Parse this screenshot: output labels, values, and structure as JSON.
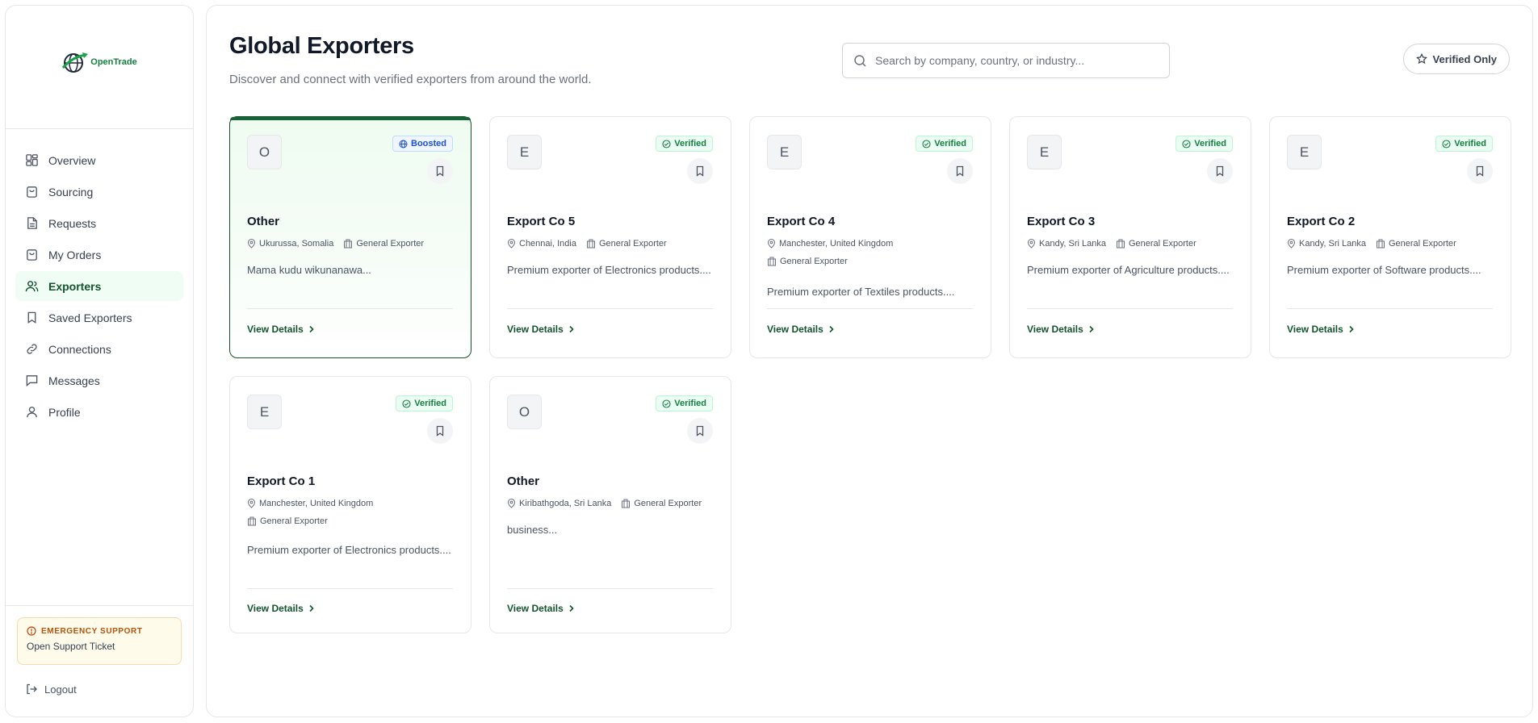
{
  "app": {
    "logo_text": "OpenTrade"
  },
  "sidebar": {
    "items": [
      {
        "label": "Overview",
        "icon": "grid-icon"
      },
      {
        "label": "Sourcing",
        "icon": "shopping-bag-icon"
      },
      {
        "label": "Requests",
        "icon": "document-icon"
      },
      {
        "label": "My Orders",
        "icon": "shopping-bag-icon"
      },
      {
        "label": "Exporters",
        "icon": "users-icon",
        "active": true
      },
      {
        "label": "Saved Exporters",
        "icon": "bookmark-icon"
      },
      {
        "label": "Connections",
        "icon": "link-icon"
      },
      {
        "label": "Messages",
        "icon": "message-icon"
      },
      {
        "label": "Profile",
        "icon": "user-icon"
      }
    ],
    "emergency": {
      "title": "EMERGENCY SUPPORT",
      "subtitle": "Open Support Ticket"
    },
    "logout_label": "Logout"
  },
  "header": {
    "title": "Global Exporters",
    "subtitle": "Discover and connect with verified exporters from around the world.",
    "search_placeholder": "Search by company, country, or industry...",
    "filter_label": "Verified Only"
  },
  "cards": [
    {
      "initial": "O",
      "badge": "Boosted",
      "badge_type": "boost",
      "name": "Other",
      "location": "Ukurussa, Somalia",
      "category": "General Exporter",
      "description": "Mama kudu wikunanawa...",
      "action": "View Details"
    },
    {
      "initial": "E",
      "badge": "Verified",
      "badge_type": "verified",
      "name": "Export Co 5",
      "location": "Chennai, India",
      "category": "General Exporter",
      "description": "Premium exporter of Electronics products....",
      "action": "View Details"
    },
    {
      "initial": "E",
      "badge": "Verified",
      "badge_type": "verified",
      "name": "Export Co 4",
      "location": "Manchester, United Kingdom",
      "category": "General Exporter",
      "description": "Premium exporter of Textiles products....",
      "action": "View Details"
    },
    {
      "initial": "E",
      "badge": "Verified",
      "badge_type": "verified",
      "name": "Export Co 3",
      "location": "Kandy, Sri Lanka",
      "category": "General Exporter",
      "description": "Premium exporter of Agriculture products....",
      "action": "View Details"
    },
    {
      "initial": "E",
      "badge": "Verified",
      "badge_type": "verified",
      "name": "Export Co 2",
      "location": "Kandy, Sri Lanka",
      "category": "General Exporter",
      "description": "Premium exporter of Software products....",
      "action": "View Details"
    },
    {
      "initial": "E",
      "badge": "Verified",
      "badge_type": "verified",
      "name": "Export Co 1",
      "location": "Manchester, United Kingdom",
      "category": "General Exporter",
      "description": "Premium exporter of Electronics products....",
      "action": "View Details"
    },
    {
      "initial": "O",
      "badge": "Verified",
      "badge_type": "verified",
      "name": "Other",
      "location": "Kiribathgoda, Sri Lanka",
      "category": "General Exporter",
      "description": "business...",
      "action": "View Details"
    }
  ],
  "colors": {
    "accent": "#14532d",
    "verified": "#15803d",
    "boost": "#1d4ed8",
    "emergency": "#b45309"
  }
}
